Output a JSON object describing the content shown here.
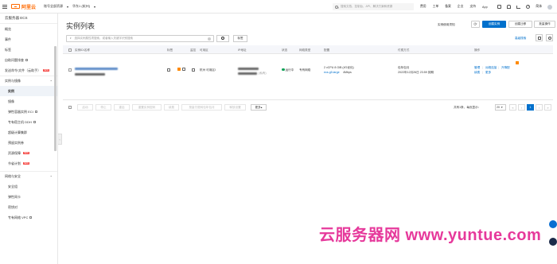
{
  "topbar": {
    "logo_text": "阿里云",
    "workspace": "账号全部资源",
    "region": "华东1 (杭州)",
    "search_placeholder": "搜索文档、控制台、API、解决方案和资源",
    "links": [
      "费用",
      "工单",
      "备案",
      "企业",
      "支持",
      "App"
    ],
    "lang": "简体"
  },
  "sidebar": {
    "title": "云服务器 ECS",
    "top_items": [
      "概览",
      "事件",
      "标签",
      "自助问题排查",
      "发送命令/文件（云助手）"
    ],
    "group1": "实例与镜像",
    "group1_items": [
      "实例",
      "镜像",
      "弹性容器实例 ECI",
      "专有宿主机 DDH",
      "超级计算集群",
      "预留实例券",
      "资源保障",
      "节省计划"
    ],
    "group2": "网络与安全",
    "group2_items": [
      "安全组",
      "弹性网卡",
      "密钥对",
      "专有网络 VPC"
    ],
    "new_badge": "NEW"
  },
  "main": {
    "title": "实例列表",
    "help_link": "实例使用须知",
    "refresh_symbol": "⟳",
    "btn_create": "创建实例",
    "btn_bulk_create": "创建迁移",
    "btn_batch": "批量操作",
    "filter_placeholder": "选择实例属性项搜索，或者输入关键字识别搜索",
    "tag_button": "标签",
    "adv_search": "高级搜索"
  },
  "table": {
    "headers": [
      "实例ID/名称",
      "标签",
      "监控",
      "可用区",
      "IP地址",
      "状态",
      "网络类型",
      "配置",
      "付费方式",
      "操作"
    ],
    "row": {
      "zone": "杭州 可用区I",
      "ip_suffix": "(私有)",
      "status": "运行中",
      "network": "专有网络",
      "config_line1": "2 vCPU 8 GiB (I/O优化)",
      "config_line2": "ecs.g5.large",
      "config_line3": "4Mbps",
      "pay_line1": "包年包月",
      "pay_line2": "2022年12月26日 23:59 到期",
      "ops_line1": [
        "管理",
        "远程连接",
        "升降配"
      ],
      "ops_line2": [
        "续费",
        "更多"
      ]
    }
  },
  "footer": {
    "buttons": [
      "启动",
      "停止",
      "重启",
      "重置实例密码",
      "续费",
      "按量付费转包年包月",
      "释放设置"
    ],
    "more": "更多",
    "pager_text": "共有1条，每页显示：",
    "page_size": "20",
    "current_page": "1"
  },
  "watermark": "云服务器网 www.yuntue.com"
}
